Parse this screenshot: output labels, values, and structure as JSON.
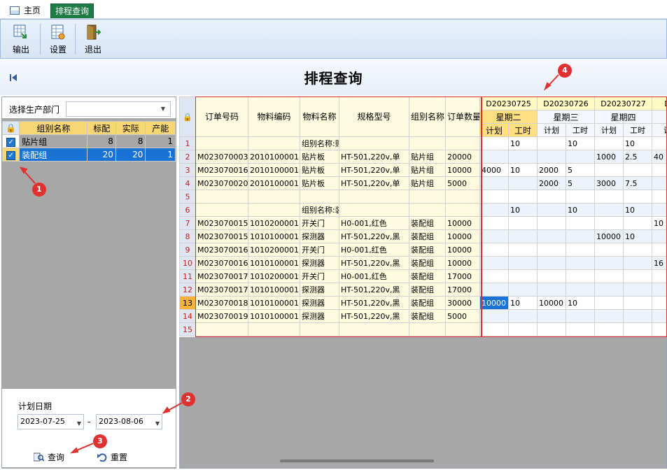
{
  "tabs": {
    "home": "主页",
    "schedule": "排程查询"
  },
  "toolbar": {
    "export": "输出",
    "settings": "设置",
    "exit": "退出"
  },
  "page_title": "排程查询",
  "left": {
    "dept_label": "选择生产部门",
    "dept_value": "",
    "columns": [
      "组别名称",
      "标配",
      "实际",
      "产能"
    ],
    "rows": [
      {
        "name": "贴片组",
        "std": "8",
        "actual": "8",
        "cap": "1",
        "checked": true
      },
      {
        "name": "装配组",
        "std": "20",
        "actual": "20",
        "cap": "1",
        "checked": true
      }
    ],
    "date_label": "计划日期",
    "date_from": "2023-07-25",
    "date_sep": "-",
    "date_to": "2023-08-06",
    "query": "查询",
    "reset": "重置"
  },
  "grid": {
    "fixed_headers": [
      "订单号码",
      "物料编码",
      "物料名称",
      "规格型号",
      "组别名称",
      "订单数量"
    ],
    "days": [
      {
        "code": "D20230725",
        "week": "星期二"
      },
      {
        "code": "D20230726",
        "week": "星期三"
      },
      {
        "code": "D20230727",
        "week": "星期四"
      },
      {
        "code": "D",
        "week": ""
      }
    ],
    "sub_headers": [
      "计划",
      "工时",
      "计划",
      "工时",
      "计划",
      "工时",
      "计"
    ],
    "rows": [
      {
        "no": "1",
        "fixed": [
          "",
          "",
          "组别名称:贴",
          "",
          "",
          ""
        ],
        "days": [
          "",
          "10",
          "",
          "10",
          "",
          "10",
          ""
        ]
      },
      {
        "no": "2",
        "fixed": [
          "M023070003",
          "2010100001",
          "贴片板",
          "HT-501,220v,单",
          "贴片组",
          "20000"
        ],
        "days": [
          "",
          "",
          "",
          "",
          "1000",
          "2.5",
          "40"
        ]
      },
      {
        "no": "3",
        "fixed": [
          "M023070016",
          "2010100001",
          "贴片板",
          "HT-501,220v,单",
          "贴片组",
          "10000"
        ],
        "days": [
          "4000",
          "10",
          "2000",
          "5",
          "",
          "",
          ""
        ]
      },
      {
        "no": "4",
        "fixed": [
          "M023070020",
          "2010100001",
          "贴片板",
          "HT-501,220v,单",
          "贴片组",
          "5000"
        ],
        "days": [
          "",
          "",
          "2000",
          "5",
          "3000",
          "7.5",
          ""
        ]
      },
      {
        "no": "5",
        "fixed": [
          "",
          "",
          "",
          "",
          "",
          ""
        ],
        "days": [
          "",
          "",
          "",
          "",
          "",
          "",
          ""
        ]
      },
      {
        "no": "6",
        "fixed": [
          "",
          "",
          "组别名称:装",
          "",
          "",
          ""
        ],
        "days": [
          "",
          "10",
          "",
          "10",
          "",
          "10",
          ""
        ]
      },
      {
        "no": "7",
        "fixed": [
          "M023070015",
          "1010200001",
          "开关门",
          "H0-001,红色",
          "装配组",
          "10000"
        ],
        "days": [
          "",
          "",
          "",
          "",
          "",
          "",
          "10"
        ]
      },
      {
        "no": "8",
        "fixed": [
          "M023070015",
          "1010100001",
          "探测器",
          "HT-501,220v,黑",
          "装配组",
          "10000"
        ],
        "days": [
          "",
          "",
          "",
          "",
          "10000",
          "10",
          ""
        ]
      },
      {
        "no": "9",
        "fixed": [
          "M023070016",
          "1010200001",
          "开关门",
          "H0-001,红色",
          "装配组",
          "10000"
        ],
        "days": [
          "",
          "",
          "",
          "",
          "",
          "",
          ""
        ]
      },
      {
        "no": "10",
        "fixed": [
          "M023070016",
          "1010100001",
          "探测器",
          "HT-501,220v,黑",
          "装配组",
          "10000"
        ],
        "days": [
          "",
          "",
          "",
          "",
          "",
          "",
          "16"
        ]
      },
      {
        "no": "11",
        "fixed": [
          "M023070017",
          "1010200001",
          "开关门",
          "H0-001,红色",
          "装配组",
          "17000"
        ],
        "days": [
          "",
          "",
          "",
          "",
          "",
          "",
          ""
        ]
      },
      {
        "no": "12",
        "fixed": [
          "M023070017",
          "1010100001",
          "探测器",
          "HT-501,220v,黑",
          "装配组",
          "17000"
        ],
        "days": [
          "",
          "",
          "",
          "",
          "",
          "",
          ""
        ]
      },
      {
        "no": "13",
        "fixed": [
          "M023070018",
          "1010100001",
          "探测器",
          "HT-501,220v,黑",
          "装配组",
          "30000"
        ],
        "days": [
          "10000",
          "10",
          "10000",
          "10",
          "",
          "",
          ""
        ]
      },
      {
        "no": "14",
        "fixed": [
          "M023070019",
          "1010100001",
          "探测器",
          "HT-501,220v,黑",
          "装配组",
          "5000"
        ],
        "days": [
          "",
          "",
          "",
          "",
          "",
          "",
          ""
        ]
      },
      {
        "no": "15",
        "fixed": [
          "",
          "",
          "",
          "",
          "",
          ""
        ],
        "days": [
          "",
          "",
          "",
          "",
          "",
          "",
          ""
        ]
      }
    ]
  },
  "annotations": [
    "1",
    "2",
    "3",
    "4"
  ],
  "colors": {
    "accent": "#1a73d4",
    "annotation": "#e03131",
    "tab_active": "#1e7b45",
    "header_yellow": "#f7d774"
  }
}
